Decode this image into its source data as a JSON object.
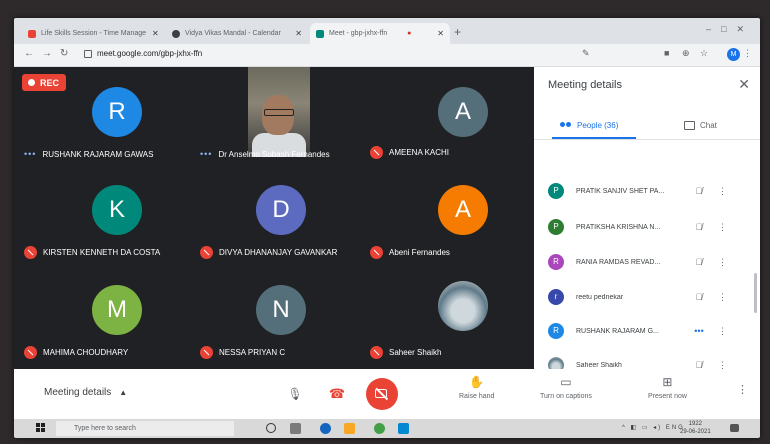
{
  "browser": {
    "tabs": [
      {
        "label": "Life Skills Session - Time Manage",
        "favicon_color": "#ea4335"
      },
      {
        "label": "Vidya Vikas Mandal - Calendar",
        "favicon_color": "#3c4043"
      },
      {
        "label": "Meet - gbp-jxhx-ffn",
        "favicon_color": "#00897b",
        "active": true
      }
    ],
    "url": "meet.google.com/gbp-jxhx-ffn",
    "profile_initial": "M"
  },
  "recording": {
    "label": "REC",
    "color": "#ea4335"
  },
  "participants_grid": [
    {
      "name": "RUSHANK RAJARAM GAWAS",
      "initial": "R",
      "avatar_color": "#1e88e5",
      "status": "talking"
    },
    {
      "name": "Dr Anselmo Subash Fernandes",
      "initial": "",
      "avatar_color": "",
      "status": "talking",
      "video": true
    },
    {
      "name": "AMEENA KACHI",
      "initial": "A",
      "avatar_color": "#546e7a",
      "status": "muted"
    },
    {
      "name": "KIRSTEN KENNETH DA COSTA",
      "initial": "K",
      "avatar_color": "#00897b",
      "status": "muted"
    },
    {
      "name": "DIVYA DHANANJAY GAVANKAR",
      "initial": "D",
      "avatar_color": "#5c6bc0",
      "status": "muted"
    },
    {
      "name": "Abeni Fernandes",
      "initial": "A",
      "avatar_color": "#f57c00",
      "status": "muted"
    },
    {
      "name": "MAHIMA CHOUDHARY",
      "initial": "M",
      "avatar_color": "#7cb342",
      "status": "muted"
    },
    {
      "name": "NESSA PRIYAN C",
      "initial": "N",
      "avatar_color": "#546e7a",
      "status": "muted"
    },
    {
      "name": "Saheer Shaikh",
      "initial": "",
      "avatar_color": "",
      "status": "muted",
      "photo": true
    }
  ],
  "panel": {
    "title": "Meeting details",
    "tabs": {
      "people": "People (36)",
      "chat": "Chat"
    },
    "people": [
      {
        "name": "PRATIK SANJIV SHET PA...",
        "initial": "P",
        "avatar_color": "#00897b",
        "status": "muted"
      },
      {
        "name": "PRATIKSHA KRISHNA N...",
        "initial": "P",
        "avatar_color": "#2e7d32",
        "status": "muted"
      },
      {
        "name": "RANIA RAMDAS REVAD...",
        "initial": "R",
        "avatar_color": "#ab47bc",
        "status": "muted"
      },
      {
        "name": "reetu pednekar",
        "initial": "r",
        "avatar_color": "#3949ab",
        "status": "muted"
      },
      {
        "name": "RUSHANK RAJARAM G...",
        "initial": "R",
        "avatar_color": "#1e88e5",
        "status": "talking"
      },
      {
        "name": "Saheer Shaikh",
        "initial": "",
        "avatar_color": "#607d8b",
        "status": "muted",
        "photo": true
      }
    ]
  },
  "controls": {
    "details_label": "Meeting details",
    "raise_hand": "Raise hand",
    "captions": "Turn on captions",
    "present": "Present now"
  },
  "taskbar": {
    "search_placeholder": "Type here to search",
    "clock_time": "1922",
    "clock_date": "29-06-2021",
    "lang": "ENG"
  }
}
